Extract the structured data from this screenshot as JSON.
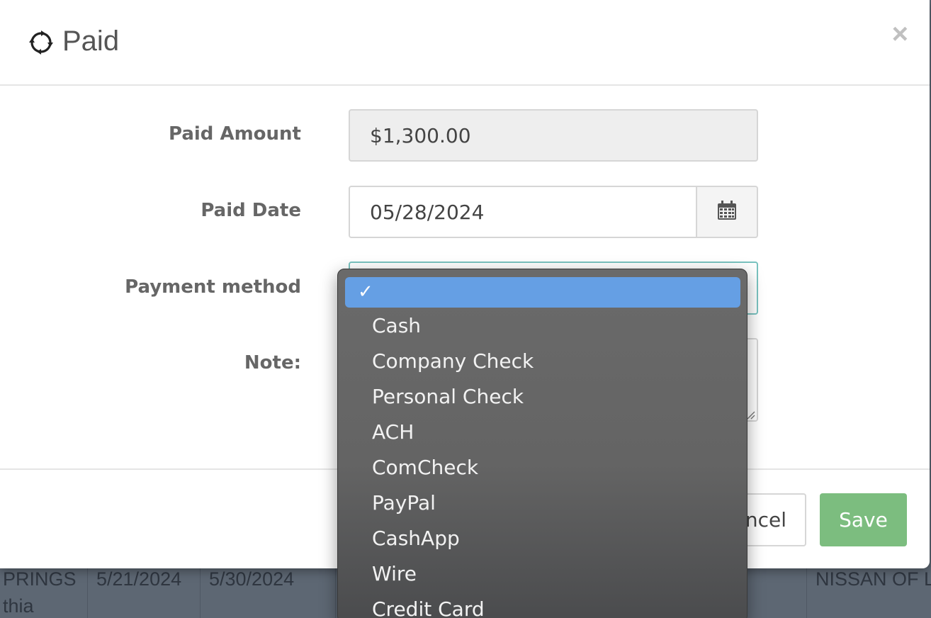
{
  "modal": {
    "title": "Paid",
    "close_label": "×",
    "icon": "refresh-circle-icon"
  },
  "form": {
    "paid_amount_label": "Paid Amount",
    "paid_amount_value": "$1,300.00",
    "paid_date_label": "Paid Date",
    "paid_date_value": "05/28/2024",
    "payment_method_label": "Payment method",
    "payment_method_value": "",
    "note_label": "Note:",
    "note_value": ""
  },
  "footer": {
    "cancel_label": "ncel",
    "save_label": "Save"
  },
  "dropdown": {
    "check_mark": "✓",
    "options": [
      "Cash",
      "Company Check",
      "Personal Check",
      "ACH",
      "ComCheck",
      "PayPal",
      "CashApp",
      "Wire",
      "Credit Card"
    ]
  },
  "background_table": {
    "row_line1": [
      "PRINGS",
      "5/21/2024",
      "5/30/2024",
      "NISSAN OF L"
    ],
    "row_line2": [
      "thia"
    ]
  },
  "colors": {
    "save_button": "#7cbd7f",
    "dropdown_highlight": "#659fe4",
    "select_focus_border": "#7ac3c0"
  }
}
